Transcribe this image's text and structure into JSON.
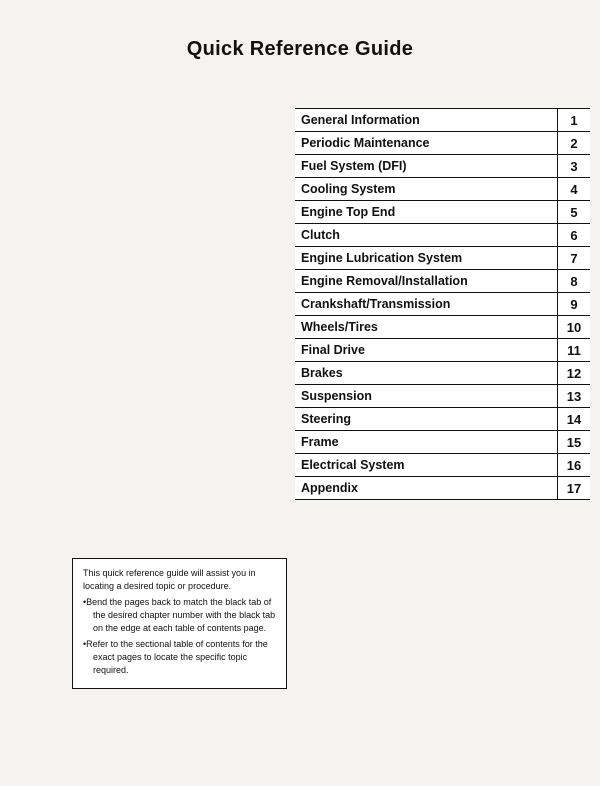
{
  "title": "Quick Reference Guide",
  "toc": {
    "items": [
      {
        "label": "General Information",
        "number": "1"
      },
      {
        "label": "Periodic Maintenance",
        "number": "2"
      },
      {
        "label": "Fuel System (DFI)",
        "number": "3"
      },
      {
        "label": "Cooling System",
        "number": "4"
      },
      {
        "label": "Engine Top End",
        "number": "5"
      },
      {
        "label": "Clutch",
        "number": "6"
      },
      {
        "label": "Engine Lubrication System",
        "number": "7"
      },
      {
        "label": "Engine Removal/Installation",
        "number": "8"
      },
      {
        "label": "Crankshaft/Transmission",
        "number": "9"
      },
      {
        "label": "Wheels/Tires",
        "number": "10"
      },
      {
        "label": "Final Drive",
        "number": "11"
      },
      {
        "label": "Brakes",
        "number": "12"
      },
      {
        "label": "Suspension",
        "number": "13"
      },
      {
        "label": "Steering",
        "number": "14"
      },
      {
        "label": "Frame",
        "number": "15"
      },
      {
        "label": "Electrical System",
        "number": "16"
      },
      {
        "label": "Appendix",
        "number": "17"
      }
    ]
  },
  "note": {
    "intro": "This quick reference guide will assist you in locating a desired topic or procedure.",
    "bullet1": "Bend the pages back to match the black tab of the desired chapter number with the black tab on the edge at each table of contents page.",
    "bullet2": "Refer to the sectional table of contents for the exact pages to locate the specific topic required."
  }
}
